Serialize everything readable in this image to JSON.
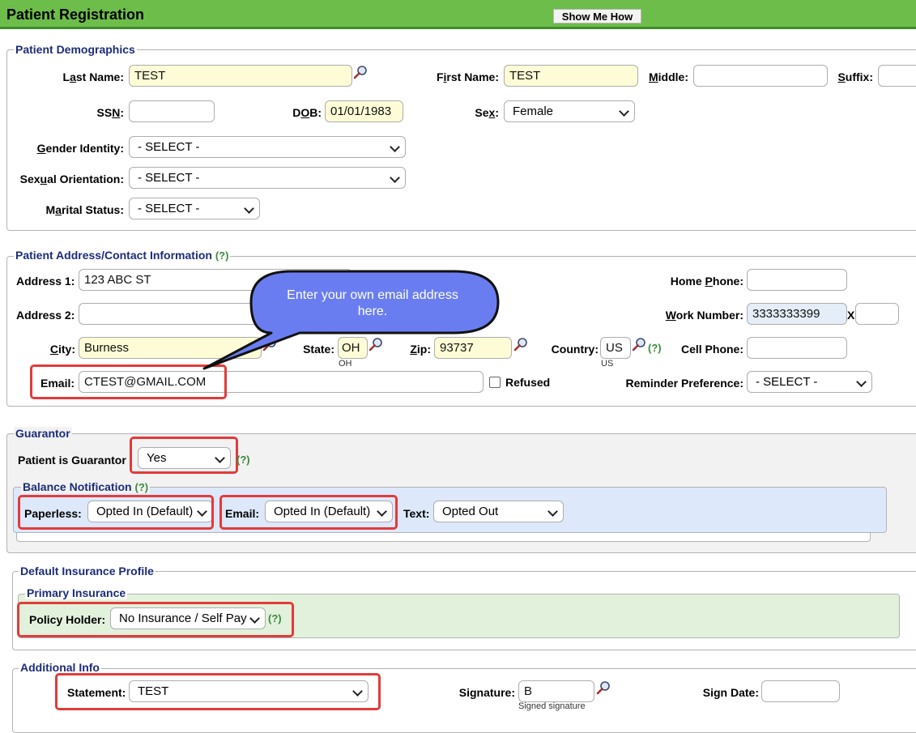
{
  "header": {
    "title": "Patient Registration",
    "show_me_how": "Show Me How"
  },
  "colors": {
    "header_green": "#6dbd4a",
    "required_yellow": "#fdfcd6",
    "callout_blue": "#6a7df0",
    "highlight_red": "#e23b3b",
    "legend_navy": "#1b2c7a"
  },
  "demographics": {
    "legend": "Patient Demographics",
    "last_name": {
      "label_a": "L",
      "label_u": "a",
      "label_b": "st Name:",
      "value": "TEST"
    },
    "first_name": {
      "label_a": "F",
      "label_u": "i",
      "label_b": "rst Name:",
      "value": "TEST"
    },
    "middle": {
      "label_u": "M",
      "label_b": "iddle:",
      "value": ""
    },
    "suffix": {
      "label_u": "S",
      "label_b": "uffix:",
      "value": ""
    },
    "ssn": {
      "label_a": "SS",
      "label_u": "N",
      "label_b": ":",
      "value": ""
    },
    "dob": {
      "label_a": "D",
      "label_u": "O",
      "label_b": "B:",
      "value": "01/01/1983"
    },
    "sex": {
      "label_a": "Se",
      "label_u": "x",
      "label_b": ":",
      "value": "Female"
    },
    "gender_identity": {
      "label_u": "G",
      "label_b": "ender Identity:",
      "value": "- SELECT -"
    },
    "sexual_orientation": {
      "label_a": "Sex",
      "label_u": "u",
      "label_b": "al Orientation:",
      "value": "- SELECT -"
    },
    "marital_status": {
      "label_a": "M",
      "label_u": "a",
      "label_b": "rital Status:",
      "value": "- SELECT -"
    }
  },
  "address": {
    "legend": "Patient Address/Contact Information",
    "help": "(?)",
    "address1": {
      "label": "Address 1:",
      "value": "123 ABC ST"
    },
    "address2": {
      "label": "Address 2:",
      "value": ""
    },
    "city": {
      "label_u": "C",
      "label_b": "ity:",
      "value": "Burness"
    },
    "state": {
      "label": "State:",
      "value": "OH",
      "sub": "OH"
    },
    "zip": {
      "label_u": "Z",
      "label_b": "ip:",
      "value": "93737"
    },
    "country": {
      "label": "Country:",
      "value": "US",
      "sub": "US"
    },
    "home_phone": {
      "label_a": "Home ",
      "label_u": "P",
      "label_b": "hone:",
      "value": ""
    },
    "work_number": {
      "label_u": "W",
      "label_b": "ork Number:",
      "value": "3333333399",
      "ext_label": "X",
      "ext_value": ""
    },
    "cell_phone": {
      "label": "Cell Phone:",
      "value": ""
    },
    "email": {
      "label": "Email:",
      "value": "CTEST@GMAIL.COM"
    },
    "refused": {
      "label": "Refused"
    },
    "reminder": {
      "label": "Reminder Preference:",
      "value": "- SELECT -"
    }
  },
  "callout": {
    "text": "Enter your own email address here."
  },
  "guarantor": {
    "legend": "Guarantor",
    "label": "Patient is Guarantor",
    "value": "Yes",
    "help": "(?)",
    "balance": {
      "legend": "Balance Notification",
      "help": "(?)",
      "paperless": {
        "label": "Paperless:",
        "value": "Opted In (Default)"
      },
      "email": {
        "label": "Email:",
        "value": "Opted In (Default)"
      },
      "text": {
        "label": "Text:",
        "value": "Opted Out"
      }
    }
  },
  "insurance": {
    "legend": "Default Insurance Profile",
    "primary_legend": "Primary Insurance",
    "policy_holder": {
      "label": "Policy Holder:",
      "value": "No Insurance / Self Pay"
    },
    "help": "(?)"
  },
  "additional": {
    "legend": "Additional Info",
    "statement": {
      "label": "Statement:",
      "value": "TEST"
    },
    "signature": {
      "label": "Signature:",
      "value": "B",
      "sub": "Signed signature"
    },
    "sign_date": {
      "label": "Sign Date:",
      "value": ""
    }
  }
}
